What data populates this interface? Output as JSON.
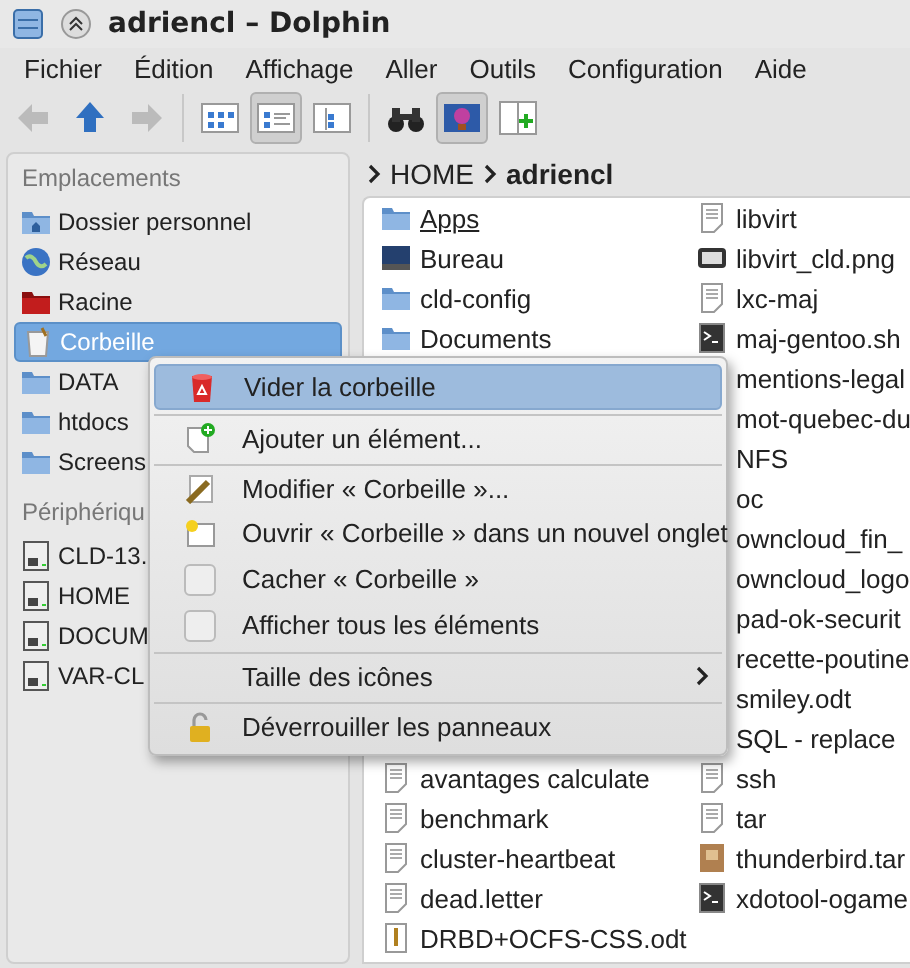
{
  "window": {
    "title": "adriencl – Dolphin"
  },
  "menu_bar": [
    "Fichier",
    "Édition",
    "Affichage",
    "Aller",
    "Outils",
    "Configuration",
    "Aide"
  ],
  "toolbar": [
    {
      "kind": "back",
      "disabled": true,
      "selected": false
    },
    {
      "kind": "up",
      "disabled": false,
      "selected": false
    },
    {
      "kind": "forward",
      "disabled": true,
      "selected": false
    },
    {
      "kind": "icons-view",
      "disabled": false,
      "selected": false
    },
    {
      "kind": "details-view",
      "disabled": false,
      "selected": true
    },
    {
      "kind": "columns-view",
      "disabled": false,
      "selected": false
    },
    {
      "kind": "find",
      "disabled": false,
      "selected": false
    },
    {
      "kind": "preview",
      "disabled": false,
      "selected": true
    },
    {
      "kind": "split",
      "disabled": false,
      "selected": false
    }
  ],
  "sidebar": {
    "sections": [
      {
        "title": "Emplacements",
        "items": [
          {
            "label": "Dossier personnel",
            "kind": "home",
            "selected": false
          },
          {
            "label": "Réseau",
            "kind": "network",
            "selected": false
          },
          {
            "label": "Racine",
            "kind": "root",
            "selected": false
          },
          {
            "label": "Corbeille",
            "kind": "trash",
            "selected": true
          },
          {
            "label": "DATA",
            "kind": "folder",
            "selected": false
          },
          {
            "label": "htdocs",
            "kind": "folder",
            "selected": false
          },
          {
            "label": "Screens",
            "kind": "folder",
            "selected": false
          }
        ]
      },
      {
        "title": "Périphériqu",
        "items": [
          {
            "label": "CLD-13.",
            "kind": "drive",
            "selected": false
          },
          {
            "label": "HOME",
            "kind": "drive",
            "selected": false
          },
          {
            "label": "DOCUM",
            "kind": "drive",
            "selected": false
          },
          {
            "label": "VAR-CL",
            "kind": "drive",
            "selected": false
          }
        ]
      }
    ]
  },
  "breadcrumb": [
    "HOME",
    "adriencl"
  ],
  "file_view": {
    "column_1_top": [
      {
        "name": "Apps",
        "kind": "folder",
        "hovered": true
      },
      {
        "name": "Bureau",
        "kind": "desktop",
        "hovered": false
      },
      {
        "name": "cld-config",
        "kind": "folder",
        "hovered": false
      },
      {
        "name": "Documents",
        "kind": "folder",
        "hovered": false
      }
    ],
    "column_1_bottom": [
      {
        "name": "avantages calculate",
        "kind": "text"
      },
      {
        "name": "benchmark",
        "kind": "text"
      },
      {
        "name": "cluster-heartbeat",
        "kind": "text"
      },
      {
        "name": "dead.letter",
        "kind": "text"
      },
      {
        "name": "DRBD+OCFS-CSS.odt",
        "kind": "odt"
      }
    ],
    "column_2": [
      {
        "name": "libvirt",
        "kind": "text"
      },
      {
        "name": "libvirt_cld.png",
        "kind": "image"
      },
      {
        "name": "lxc-maj",
        "kind": "text"
      },
      {
        "name": "maj-gentoo.sh",
        "kind": "script"
      },
      {
        "name": "mentions-legal",
        "kind": "hidden"
      },
      {
        "name": "mot-quebec-du",
        "kind": "hidden"
      },
      {
        "name": "NFS",
        "kind": "hidden"
      },
      {
        "name": "oc",
        "kind": "hidden"
      },
      {
        "name": "owncloud_fin_",
        "kind": "hidden"
      },
      {
        "name": "owncloud_logo",
        "kind": "hidden"
      },
      {
        "name": "pad-ok-securit",
        "kind": "hidden"
      },
      {
        "name": "recette-poutine",
        "kind": "hidden"
      },
      {
        "name": "smiley.odt",
        "kind": "hidden"
      },
      {
        "name": "SQL - replace",
        "kind": "hidden"
      },
      {
        "name": "ssh",
        "kind": "text"
      },
      {
        "name": "tar",
        "kind": "text"
      },
      {
        "name": "thunderbird.tar",
        "kind": "archive"
      },
      {
        "name": "xdotool-ogame",
        "kind": "script"
      }
    ]
  },
  "context_menu": [
    {
      "label": "Vider la corbeille",
      "kind": "trash",
      "selected": true,
      "separator_before": false
    },
    {
      "label": "Ajouter un élément...",
      "kind": "add",
      "selected": false,
      "separator_before": true
    },
    {
      "label": "Modifier « Corbeille »...",
      "kind": "edit",
      "selected": false,
      "separator_before": true
    },
    {
      "label": "Ouvrir « Corbeille » dans un nouvel onglet",
      "kind": "tab",
      "selected": false,
      "separator_before": false
    },
    {
      "label": "Cacher « Corbeille »",
      "kind": "checkbox",
      "checked": false,
      "selected": false,
      "separator_before": false
    },
    {
      "label": "Afficher tous les éléments",
      "kind": "checkbox",
      "checked": false,
      "selected": false,
      "separator_before": false
    },
    {
      "label": "Taille des icônes",
      "kind": "submenu",
      "selected": false,
      "separator_before": true
    },
    {
      "label": "Déverrouiller les panneaux",
      "kind": "lock",
      "selected": false,
      "separator_before": true
    }
  ]
}
